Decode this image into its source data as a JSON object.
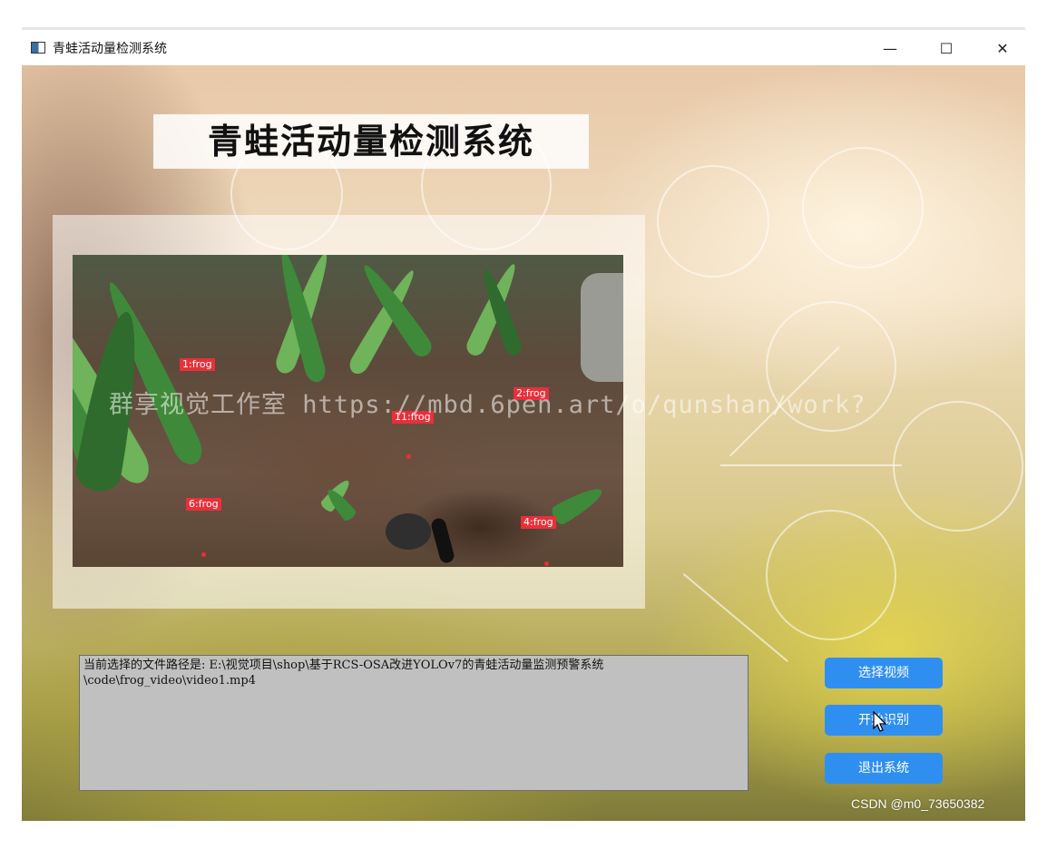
{
  "window": {
    "title": "青蛙活动量检测系统",
    "controls": {
      "minimize": "—",
      "maximize": "☐",
      "close": "✕"
    }
  },
  "header": {
    "title": "青蛙活动量检测系统"
  },
  "video": {
    "detections": [
      {
        "label": "1:frog"
      },
      {
        "label": "2:frog"
      },
      {
        "label": "11:frog"
      },
      {
        "label": "6:frog"
      },
      {
        "label": "4:frog"
      }
    ],
    "watermark": "群享视觉工作室 https://mbd.6pen.art/o/qunshan/work?"
  },
  "path_box": {
    "text": "当前选择的文件路径是: E:\\视觉项目\\shop\\基于RCS-OSA改进YOLOv7的青蛙活动量监测预警系统\n\\code\\frog_video\\video1.mp4"
  },
  "buttons": {
    "select_video": "选择视频",
    "start_detect": "开始识别",
    "exit_system": "退出系统"
  },
  "footer": {
    "credit": "CSDN @m0_73650382"
  },
  "colors": {
    "button": "#2f8ff0",
    "tag": "#e8303a",
    "path_box": "#c0c0c0"
  }
}
